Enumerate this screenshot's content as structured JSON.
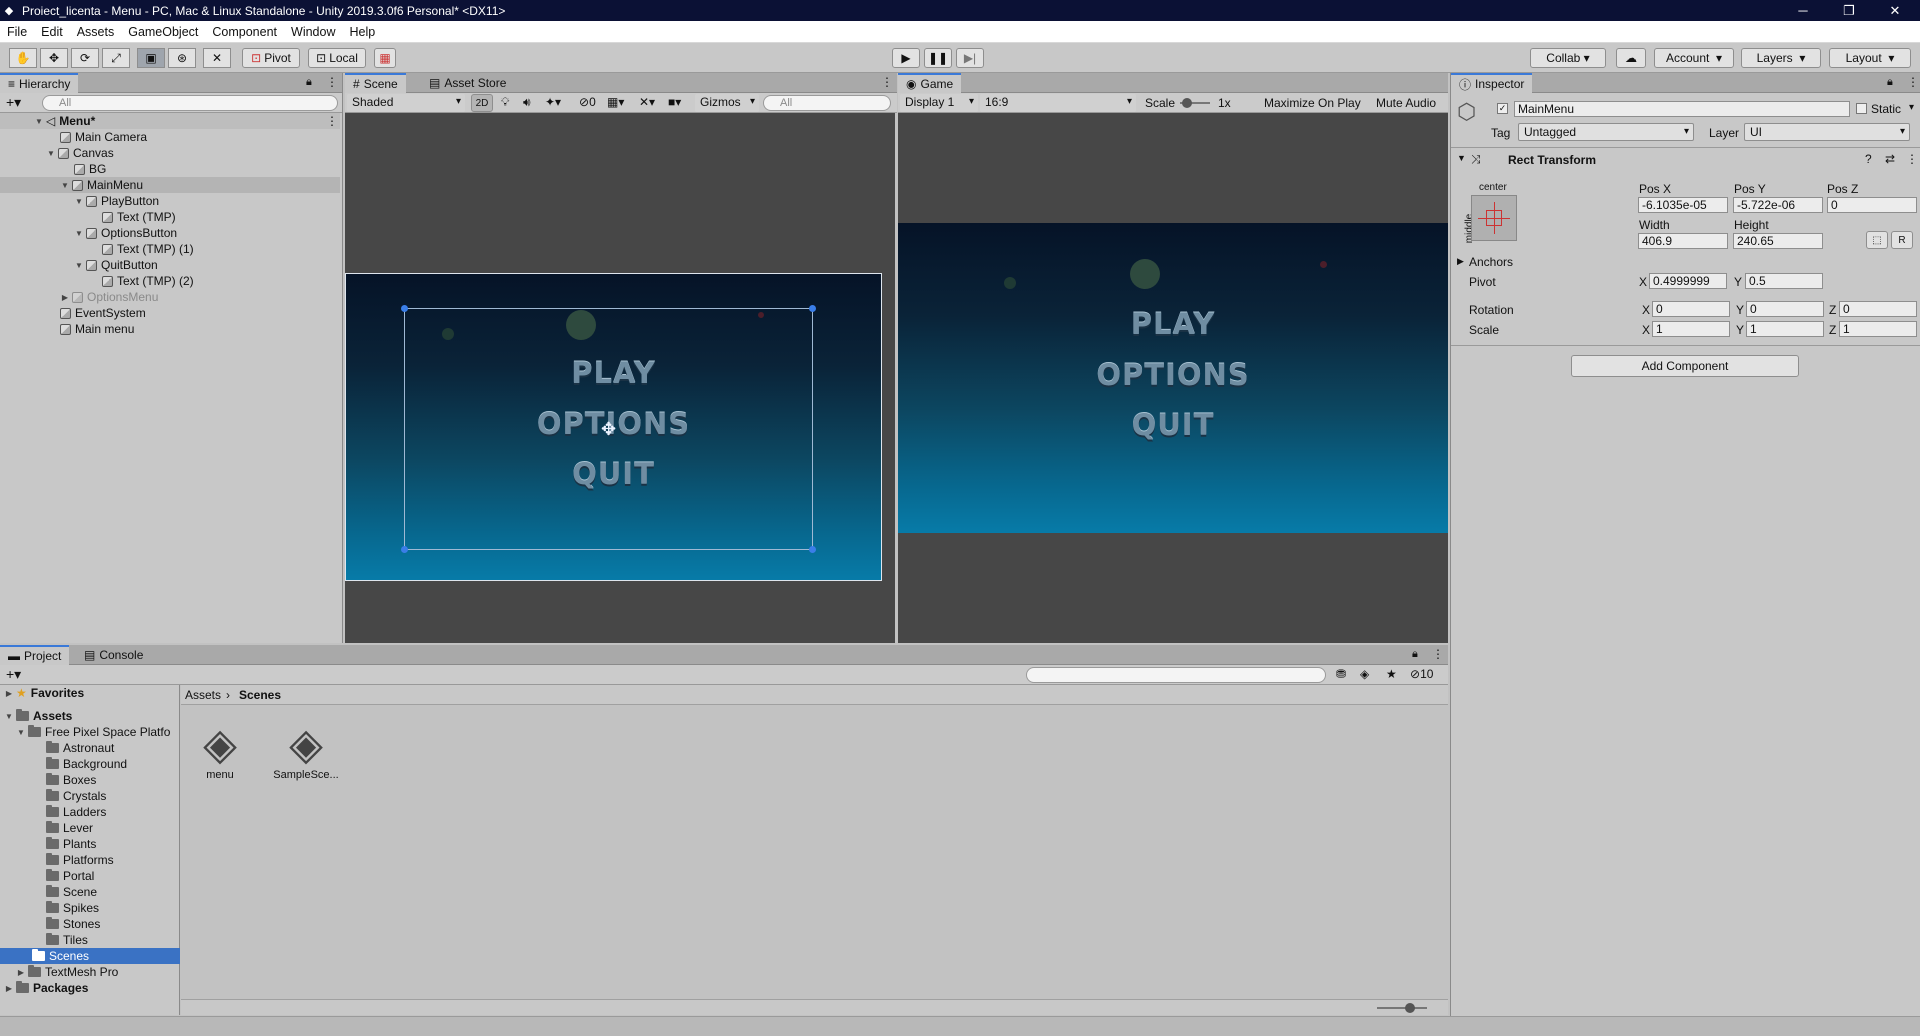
{
  "window": {
    "title": "Proiect_licenta - Menu - PC, Mac & Linux Standalone - Unity 2019.3.0f6 Personal* <DX11>"
  },
  "menubar": [
    "File",
    "Edit",
    "Assets",
    "GameObject",
    "Component",
    "Window",
    "Help"
  ],
  "toolbar": {
    "pivot": "Pivot",
    "local": "Local",
    "collab": "Collab",
    "account": "Account",
    "layers": "Layers",
    "layout": "Layout"
  },
  "hierarchy": {
    "tab": "Hierarchy",
    "search": "All",
    "scene": "Menu*",
    "items": [
      "Main Camera",
      "Canvas",
      "BG",
      "MainMenu",
      "PlayButton",
      "Text (TMP)",
      "OptionsButton",
      "Text (TMP) (1)",
      "QuitButton",
      "Text (TMP) (2)",
      "OptionsMenu",
      "EventSystem",
      "Main menu"
    ]
  },
  "scene": {
    "tab": "Scene",
    "store_tab": "Asset Store",
    "shading": "Shaded",
    "mode2d": "2D",
    "gizmos": "Gizmos",
    "search": "All",
    "hidden_count": "0"
  },
  "game": {
    "tab": "Game",
    "display": "Display 1",
    "aspect": "16:9",
    "scale_label": "Scale",
    "scale": "1x",
    "maximize": "Maximize On Play",
    "mute": "Mute Audio"
  },
  "menu_text": {
    "play": "PLAY",
    "options": "OPTIONS",
    "quit": "QUIT"
  },
  "inspector": {
    "tab": "Inspector",
    "object": "MainMenu",
    "static": "Static",
    "tag_label": "Tag",
    "tag": "Untagged",
    "layer_label": "Layer",
    "layer": "UI",
    "component": "Rect Transform",
    "anchor_h": "center",
    "anchor_v": "middle",
    "posx_label": "Pos X",
    "posy_label": "Pos Y",
    "posz_label": "Pos Z",
    "posx": "-6.1035e-05",
    "posy": "-5.722e-06",
    "posz": "0",
    "width_label": "Width",
    "height_label": "Height",
    "width": "406.9",
    "height": "240.65",
    "anchors": "Anchors",
    "pivot_label": "Pivot",
    "pivot_x": "0.4999999",
    "pivot_y": "0.5",
    "rotation_label": "Rotation",
    "rot_x": "0",
    "rot_y": "0",
    "rot_z": "0",
    "scale_label": "Scale",
    "scale_x": "1",
    "scale_y": "1",
    "scale_z": "1",
    "x": "X",
    "y": "Y",
    "z": "Z",
    "r": "R",
    "add_component": "Add Component"
  },
  "project": {
    "tab": "Project",
    "console_tab": "Console",
    "hidden_count": "10",
    "breadcrumb_root": "Assets",
    "breadcrumb_leaf": "Scenes",
    "favorites": "Favorites",
    "assets": "Assets",
    "packages": "Packages",
    "pack_folder": "Free Pixel Space Platfo",
    "folders": [
      "Astronaut",
      "Background",
      "Boxes",
      "Crystals",
      "Ladders",
      "Lever",
      "Plants",
      "Platforms",
      "Portal",
      "Scene",
      "Spikes",
      "Stones",
      "Tiles"
    ],
    "scenes_folder": "Scenes",
    "textmesh": "TextMesh Pro",
    "files": [
      "menu",
      "SampleSce..."
    ]
  },
  "colors": {
    "accent": "#3a72c4",
    "title_bar": "#0b1135"
  }
}
